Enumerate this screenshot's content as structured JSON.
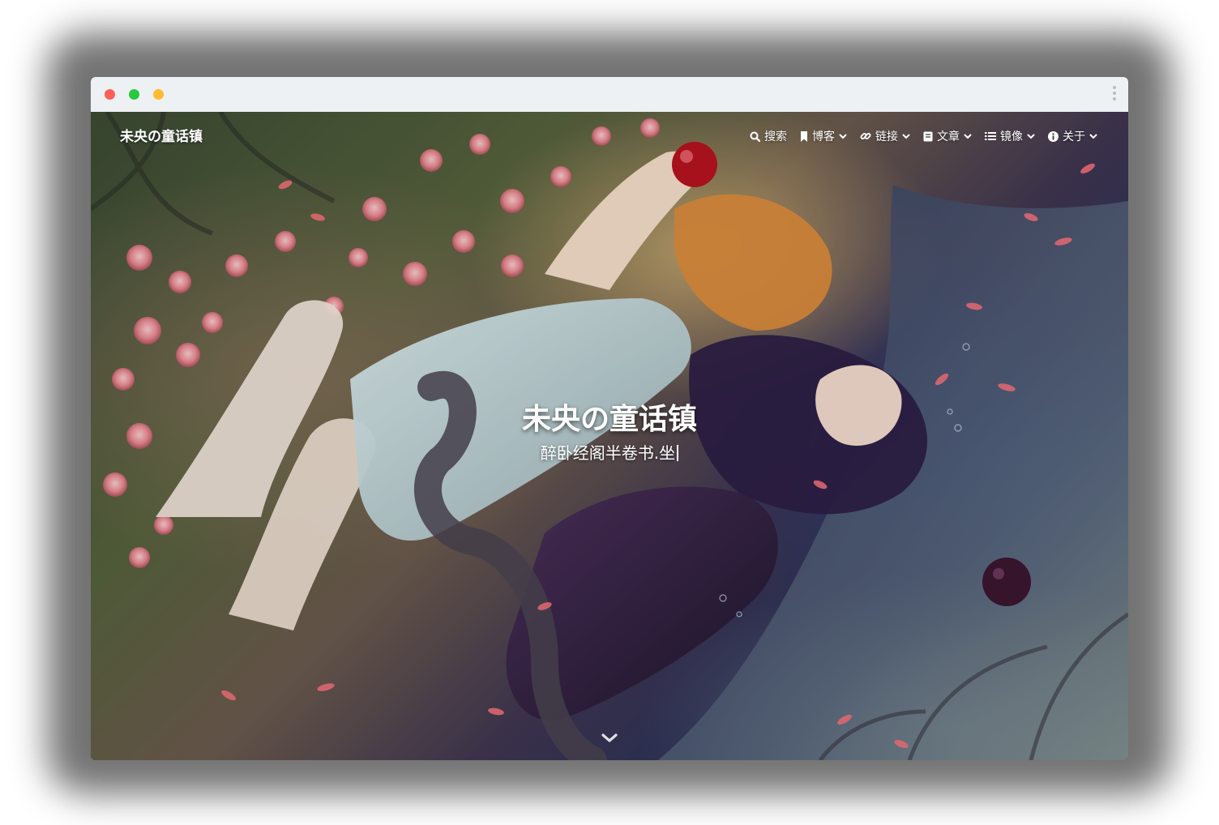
{
  "window": {
    "traffic_lights": {
      "close": "#fe5f57",
      "minimize": "#28c840",
      "zoom": "#febc2e"
    }
  },
  "site": {
    "brand": "未央の童话镇",
    "nav": [
      {
        "icon": "search-icon",
        "label": "搜索",
        "has_dropdown": false
      },
      {
        "icon": "bookmark-icon",
        "label": "博客",
        "has_dropdown": true
      },
      {
        "icon": "link-icon",
        "label": "链接",
        "has_dropdown": true
      },
      {
        "icon": "book-icon",
        "label": "文章",
        "has_dropdown": true
      },
      {
        "icon": "list-icon",
        "label": "镜像",
        "has_dropdown": true
      },
      {
        "icon": "info-icon",
        "label": "关于",
        "has_dropdown": true
      }
    ]
  },
  "hero": {
    "title": "未央の童话镇",
    "subtitle": "醉卧经阁半卷书.坐"
  }
}
